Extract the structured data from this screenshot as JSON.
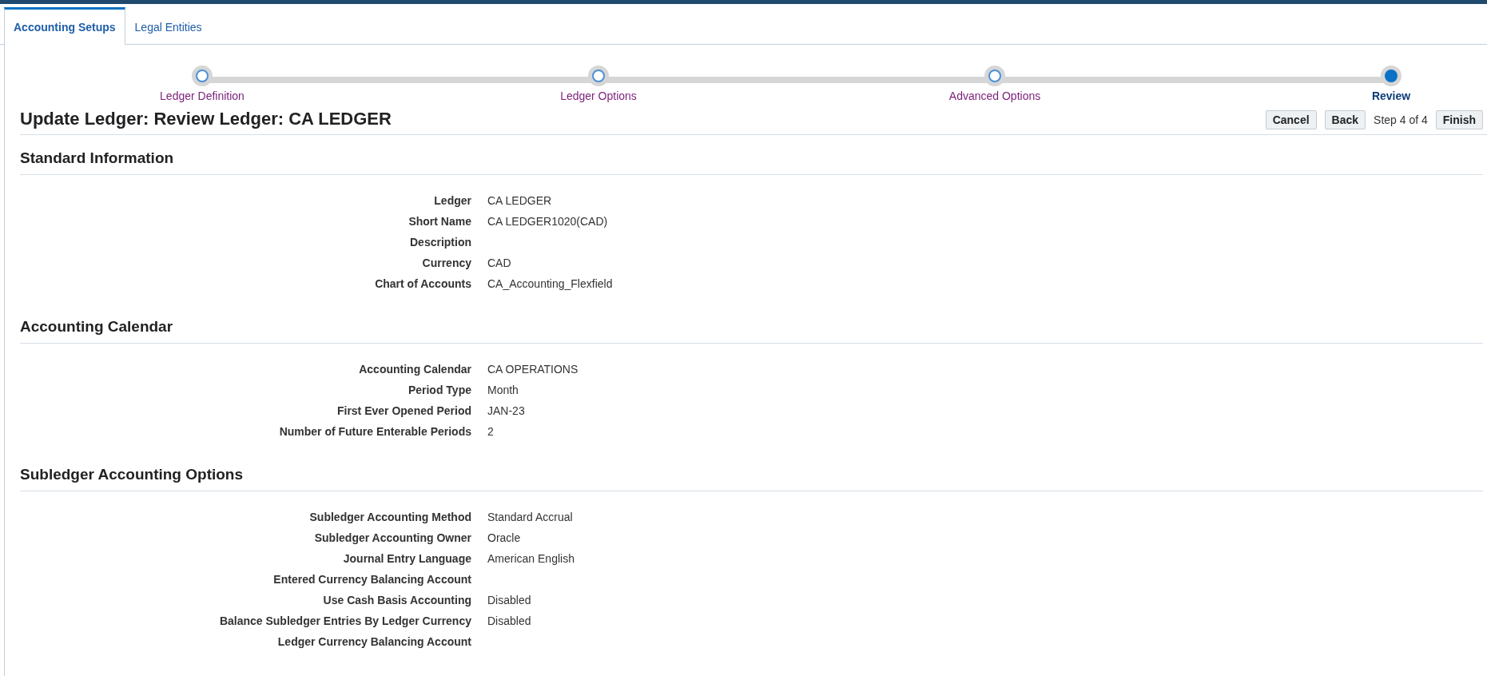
{
  "tabs": [
    {
      "label": "Accounting Setups",
      "selected": true
    },
    {
      "label": "Legal Entities",
      "selected": false
    }
  ],
  "train": [
    {
      "label": "Ledger Definition",
      "selected": false
    },
    {
      "label": "Ledger Options",
      "selected": false
    },
    {
      "label": "Advanced Options",
      "selected": false
    },
    {
      "label": "Review",
      "selected": true
    }
  ],
  "page_title": "Update Ledger: Review Ledger: CA LEDGER",
  "actions": {
    "cancel": "Cancel",
    "back": "Back",
    "step": "Step 4 of 4",
    "finish": "Finish"
  },
  "sections": [
    {
      "title": "Standard Information",
      "fields": [
        {
          "label": "Ledger",
          "value": "CA LEDGER"
        },
        {
          "label": "Short Name",
          "value": "CA LEDGER1020(CAD)"
        },
        {
          "label": "Description"
        },
        {
          "label": "Currency",
          "value": "CAD"
        },
        {
          "label": "Chart of Accounts",
          "value": "CA_Accounting_Flexfield"
        }
      ]
    },
    {
      "title": "Accounting Calendar",
      "fields": [
        {
          "label": "Accounting Calendar",
          "value": "CA OPERATIONS"
        },
        {
          "label": "Period Type",
          "value": "Month"
        },
        {
          "label": "First Ever Opened Period",
          "value": "JAN-23"
        },
        {
          "label": "Number of Future Enterable Periods",
          "value": "2"
        }
      ]
    },
    {
      "title": "Subledger Accounting Options",
      "fields": [
        {
          "label": "Subledger Accounting Method",
          "value": "Standard Accrual"
        },
        {
          "label": "Subledger Accounting Owner",
          "value": "Oracle"
        },
        {
          "label": "Journal Entry Language",
          "value": "American English"
        },
        {
          "label": "Entered Currency Balancing Account"
        },
        {
          "label": "Use Cash Basis Accounting",
          "value": "Disabled"
        },
        {
          "label": "Balance Subledger Entries By Ledger Currency",
          "value": "Disabled"
        },
        {
          "label": "Ledger Currency Balancing Account"
        }
      ]
    }
  ]
}
